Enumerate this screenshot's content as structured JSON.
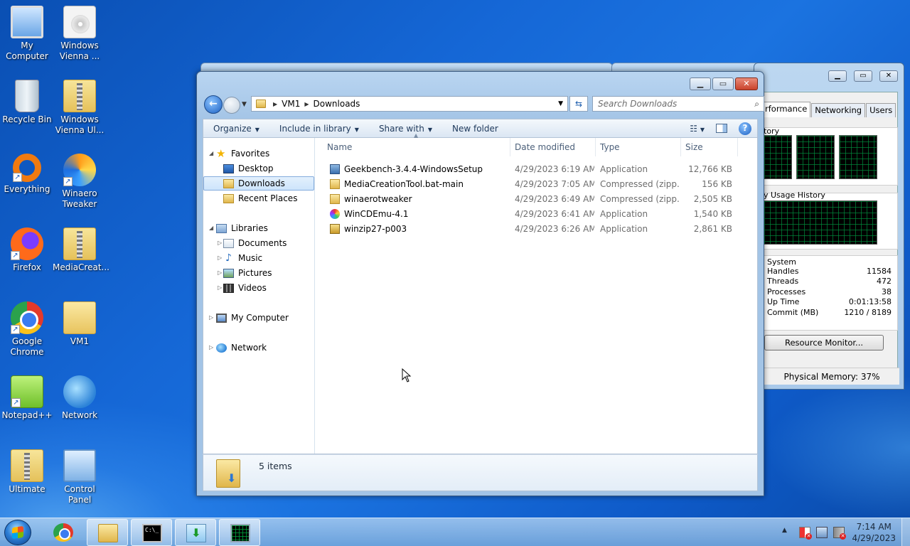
{
  "desktop_icons": [
    {
      "label": "My\nComputer"
    },
    {
      "label": "Windows\nVienna ..."
    },
    {
      "label": "Recycle Bin"
    },
    {
      "label": "Windows\nVienna Ul..."
    },
    {
      "label": "Everything"
    },
    {
      "label": "Winaero\nTweaker"
    },
    {
      "label": "Firefox"
    },
    {
      "label": "MediaCreat..."
    },
    {
      "label": "Google\nChrome"
    },
    {
      "label": "VM1"
    },
    {
      "label": "Notepad++"
    },
    {
      "label": "Network"
    },
    {
      "label": "Ultimate"
    },
    {
      "label": "Control\nPanel"
    }
  ],
  "explorer": {
    "breadcrumb": {
      "root": "VM1",
      "current": "Downloads"
    },
    "search_placeholder": "Search Downloads",
    "toolbar": {
      "organize": "Organize",
      "include_in_library": "Include in library",
      "share_with": "Share with",
      "new_folder": "New folder"
    },
    "nav": {
      "favorites": "Favorites",
      "desktop": "Desktop",
      "downloads": "Downloads",
      "recent_places": "Recent Places",
      "libraries": "Libraries",
      "documents": "Documents",
      "music": "Music",
      "pictures": "Pictures",
      "videos": "Videos",
      "my_computer": "My Computer",
      "network": "Network"
    },
    "columns": {
      "name": "Name",
      "date_modified": "Date modified",
      "type": "Type",
      "size": "Size"
    },
    "files": [
      {
        "name": "Geekbench-3.4.4-WindowsSetup",
        "date": "4/29/2023 6:19 AM",
        "type": "Application",
        "size": "12,766 KB",
        "icon": "app-icon"
      },
      {
        "name": "MediaCreationTool.bat-main",
        "date": "4/29/2023 7:05 AM",
        "type": "Compressed (zipp...",
        "size": "156 KB",
        "icon": "zip-folder-icon"
      },
      {
        "name": "winaerotweaker",
        "date": "4/29/2023 6:49 AM",
        "type": "Compressed (zipp...",
        "size": "2,505 KB",
        "icon": "zip-folder-icon"
      },
      {
        "name": "WinCDEmu-4.1",
        "date": "4/29/2023 6:41 AM",
        "type": "Application",
        "size": "1,540 KB",
        "icon": "cd-icon"
      },
      {
        "name": "winzip27-p003",
        "date": "4/29/2023 6:26 AM",
        "type": "Application",
        "size": "2,861 KB",
        "icon": "winzip-icon"
      }
    ],
    "item_count": "5 items"
  },
  "task_manager": {
    "tabs": {
      "performance": "rformance",
      "networking": "Networking",
      "users": "Users"
    },
    "labels": {
      "cpu_history": "tory",
      "memory_history": "y Usage History"
    },
    "system_title": "System",
    "stats": [
      {
        "label": "Handles",
        "value": "11584"
      },
      {
        "label": "Threads",
        "value": "472"
      },
      {
        "label": "Processes",
        "value": "38"
      },
      {
        "label": "Up Time",
        "value": "0:01:13:58"
      },
      {
        "label": "Commit (MB)",
        "value": "1210 / 8189"
      }
    ],
    "resource_monitor": "Resource Monitor...",
    "status": "Physical Memory: 37%"
  },
  "taskbar": {
    "clock_time": "7:14 AM",
    "clock_date": "4/29/2023",
    "cmd_text": "C:\\_"
  }
}
